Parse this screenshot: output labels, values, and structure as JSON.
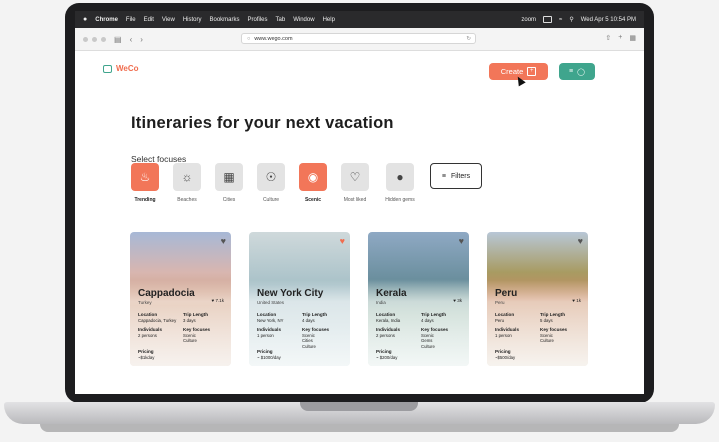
{
  "menubar": {
    "items": [
      "Chrome",
      "File",
      "Edit",
      "View",
      "History",
      "Bookmarks",
      "Profiles",
      "Tab",
      "Window",
      "Help"
    ],
    "zoom": "zoom",
    "datetime": "Wed Apr 5  10:54 PM"
  },
  "browser": {
    "url": "www.wego.com"
  },
  "app": {
    "logo_text": "WeCo",
    "create_label": "Create",
    "title": "Itineraries for your next vacation",
    "select_label": "Select focuses",
    "filters_label": "Filters",
    "focuses": [
      {
        "label": "Trending",
        "icon": "flame-icon",
        "active": true
      },
      {
        "label": "Beaches",
        "icon": "sun-icon",
        "active": false
      },
      {
        "label": "Cities",
        "icon": "building-icon",
        "active": false
      },
      {
        "label": "Culture",
        "icon": "globe-icon",
        "active": false
      },
      {
        "label": "Scenic",
        "icon": "camera-icon",
        "active": true
      },
      {
        "label": "Most liked",
        "icon": "heart-icon",
        "active": false
      },
      {
        "label": "Hidden gems",
        "icon": "ufo-icon",
        "active": false
      }
    ],
    "cards": [
      {
        "name": "Cappadocia",
        "country": "Turkey",
        "likes": "7.1k",
        "location": "Cappadocia, Turkey",
        "trip_length": "3 days",
        "individuals": "2 persons",
        "key_focuses": "Scenic\nCulture",
        "pricing": "~$1kday",
        "liked": false
      },
      {
        "name": "New York City",
        "country": "United States",
        "likes": "",
        "location": "New York, NY",
        "trip_length": "4 days",
        "individuals": "1 person",
        "key_focuses": "Scenic\nCities\nCulture",
        "pricing": "~ $1000/day",
        "liked": true
      },
      {
        "name": "Kerala",
        "country": "India",
        "likes": "3k",
        "location": "Kerala, India",
        "trip_length": "4 days",
        "individuals": "2 persons",
        "key_focuses": "Scenic\nGems\nCulture",
        "pricing": "~ $200/day",
        "liked": false
      },
      {
        "name": "Peru",
        "country": "Peru",
        "likes": "1k",
        "location": "Peru",
        "trip_length": "5 days",
        "individuals": "1 person",
        "key_focuses": "Scenic\nCulture",
        "pricing": "~$500/day",
        "liked": false
      }
    ],
    "labels": {
      "location": "Location",
      "trip_length": "Trip Length",
      "individuals": "Individuals",
      "key_focuses": "Key focuses",
      "pricing": "Pricing"
    }
  }
}
